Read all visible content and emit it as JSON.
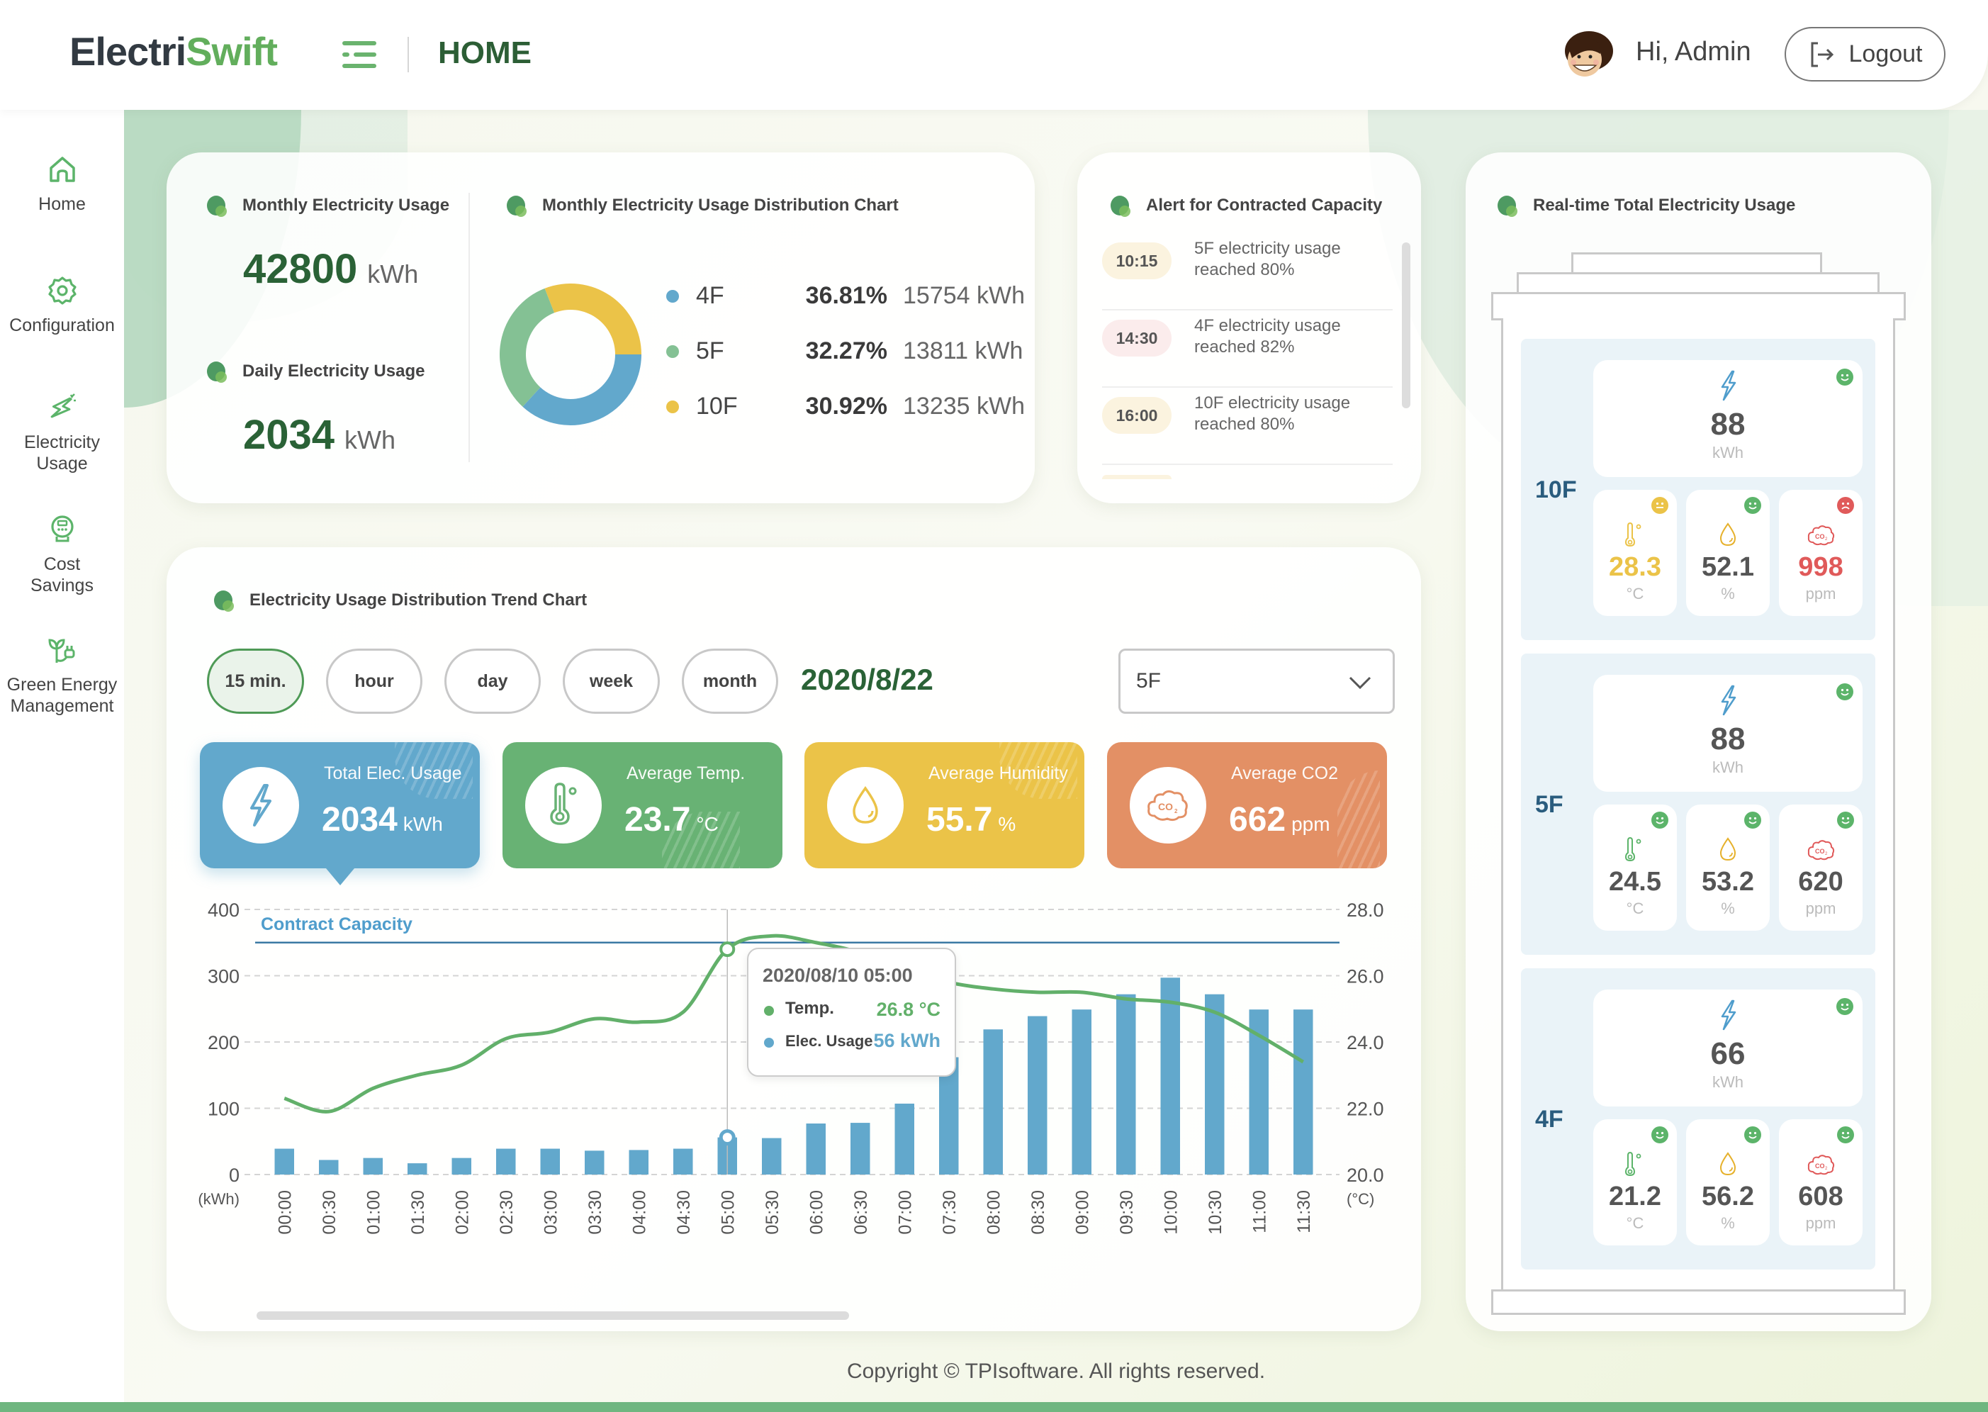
{
  "header": {
    "logo_part1": "Electri",
    "logo_part2": "Swift",
    "page_title": "HOME",
    "greeting": "Hi, Admin",
    "logout_label": "Logout"
  },
  "sidebar": {
    "items": [
      {
        "label": "Home",
        "icon": "home-icon"
      },
      {
        "label": "Configuration",
        "icon": "gear-icon"
      },
      {
        "label": "Electricity Usage",
        "icon": "lightning-icon"
      },
      {
        "label": "Cost Savings",
        "icon": "meter-icon"
      },
      {
        "label": "Green Energy Management",
        "icon": "plant-plug-icon"
      }
    ]
  },
  "summary": {
    "monthly_title": "Monthly Electricity Usage",
    "monthly_value": "42800",
    "monthly_unit": "kWh",
    "daily_title": "Daily Electricity Usage",
    "daily_value": "2034",
    "daily_unit": "kWh"
  },
  "distribution": {
    "title": "Monthly Electricity Usage Distribution Chart",
    "items": [
      {
        "name": "4F",
        "percent": "36.81%",
        "kwh": "15754 kWh",
        "color": "#62a8cc"
      },
      {
        "name": "5F",
        "percent": "32.27%",
        "kwh": "13811 kWh",
        "color": "#84c194"
      },
      {
        "name": "10F",
        "percent": "30.92%",
        "kwh": "13235 kWh",
        "color": "#ebc348"
      }
    ]
  },
  "alerts": {
    "title": "Alert for Contracted Capacity",
    "items": [
      {
        "time": "10:15",
        "message_line1": "5F electricity usage",
        "message_line2": "reached 80%",
        "badge_color": "#fbf3df"
      },
      {
        "time": "14:30",
        "message_line1": "4F electricity usage",
        "message_line2": "reached 82%",
        "badge_color": "#fbecec"
      },
      {
        "time": "16:00",
        "message_line1": "10F electricity usage",
        "message_line2": "reached 80%",
        "badge_color": "#fbf3df"
      }
    ]
  },
  "realtime": {
    "title": "Real-time Total Electricity Usage",
    "floors": [
      {
        "name": "10F",
        "usage": "88",
        "usage_unit": "kWh",
        "usage_status": "good",
        "temp": "28.3",
        "temp_unit": "°C",
        "temp_status": "neutral",
        "humidity": "52.1",
        "humidity_unit": "%",
        "humidity_status": "good",
        "co2": "998",
        "co2_unit": "ppm",
        "co2_status": "bad"
      },
      {
        "name": "5F",
        "usage": "88",
        "usage_unit": "kWh",
        "usage_status": "good",
        "temp": "24.5",
        "temp_unit": "°C",
        "temp_status": "good",
        "humidity": "53.2",
        "humidity_unit": "%",
        "humidity_status": "good",
        "co2": "620",
        "co2_unit": "ppm",
        "co2_status": "good"
      },
      {
        "name": "4F",
        "usage": "66",
        "usage_unit": "kWh",
        "usage_status": "good",
        "temp": "21.2",
        "temp_unit": "°C",
        "temp_status": "good",
        "humidity": "56.2",
        "humidity_unit": "%",
        "humidity_status": "good",
        "co2": "608",
        "co2_unit": "ppm",
        "co2_status": "good"
      }
    ],
    "status_colors": {
      "good": "#5cb46a",
      "neutral": "#ebc348",
      "bad": "#e05a5a"
    }
  },
  "trend": {
    "title": "Electricity Usage Distribution Trend Chart",
    "periods": [
      {
        "label": "15 min.",
        "active": true
      },
      {
        "label": "hour",
        "active": false
      },
      {
        "label": "day",
        "active": false
      },
      {
        "label": "week",
        "active": false
      },
      {
        "label": "month",
        "active": false
      }
    ],
    "date": "2020/8/22",
    "floor_select": "5F",
    "kpis": [
      {
        "label": "Total Elec. Usage",
        "value": "2034",
        "unit": "kWh",
        "color": "#62a8cc",
        "icon": "lightning-icon"
      },
      {
        "label": "Average Temp.",
        "value": "23.7",
        "unit": "°C",
        "color": "#68b274",
        "icon": "thermometer-icon"
      },
      {
        "label": "Average Humidity",
        "value": "55.7",
        "unit": "%",
        "color": "#ebc348",
        "icon": "droplet-icon"
      },
      {
        "label": "Average CO2",
        "value": "662",
        "unit": "ppm",
        "color": "#e39065",
        "icon": "co2-icon"
      }
    ],
    "tooltip": {
      "datetime": "2020/08/10 05:00",
      "temp_label": "Temp.",
      "temp_value": "26.8 °C",
      "usage_label": "Elec. Usage",
      "usage_value": "56 kWh"
    }
  },
  "chart_data": {
    "type": "bar",
    "title": "Electricity Usage Distribution Trend Chart",
    "categories": [
      "00:00",
      "00:30",
      "01:00",
      "01:30",
      "02:00",
      "02:30",
      "03:00",
      "03:30",
      "04:00",
      "04:30",
      "05:00",
      "05:30",
      "06:00",
      "06:30",
      "07:00",
      "07:30",
      "08:00",
      "08:30",
      "09:00",
      "09:30",
      "10:00",
      "10:30",
      "11:00",
      "11:30"
    ],
    "series": [
      {
        "name": "Elec. Usage",
        "type": "bar",
        "axis": "left",
        "color": "#62a8cc",
        "values": [
          39,
          22,
          25,
          17,
          25,
          39,
          39,
          36,
          37,
          39,
          56,
          55,
          77,
          78,
          107,
          177,
          219,
          239,
          249,
          272,
          297,
          272,
          249,
          249
        ]
      },
      {
        "name": "Temp.",
        "type": "line",
        "axis": "right",
        "color": "#62b06a",
        "values": [
          22.3,
          21.9,
          22.6,
          23.0,
          23.3,
          24.1,
          24.3,
          24.7,
          24.6,
          24.9,
          26.8,
          27.2,
          27.0,
          26.7,
          26.2,
          25.8,
          25.6,
          25.5,
          25.5,
          25.3,
          25.2,
          24.9,
          24.2,
          23.4
        ]
      }
    ],
    "reference_line": {
      "label": "Contract Capacity",
      "value": 350,
      "color": "#3b79a4"
    },
    "ylabel": "(kWh)",
    "y2label": "(°C)",
    "ylim": [
      0,
      400
    ],
    "yticks": [
      "0",
      "100",
      "200",
      "300",
      "400"
    ],
    "y2lim": [
      20,
      28
    ],
    "y2ticks": [
      "20.0",
      "22.0",
      "24.0",
      "26.0",
      "28.0"
    ],
    "highlight_index": 10,
    "grid": true
  },
  "footer": {
    "copyright": "Copyright © TPIsoftware. All rights reserved."
  }
}
